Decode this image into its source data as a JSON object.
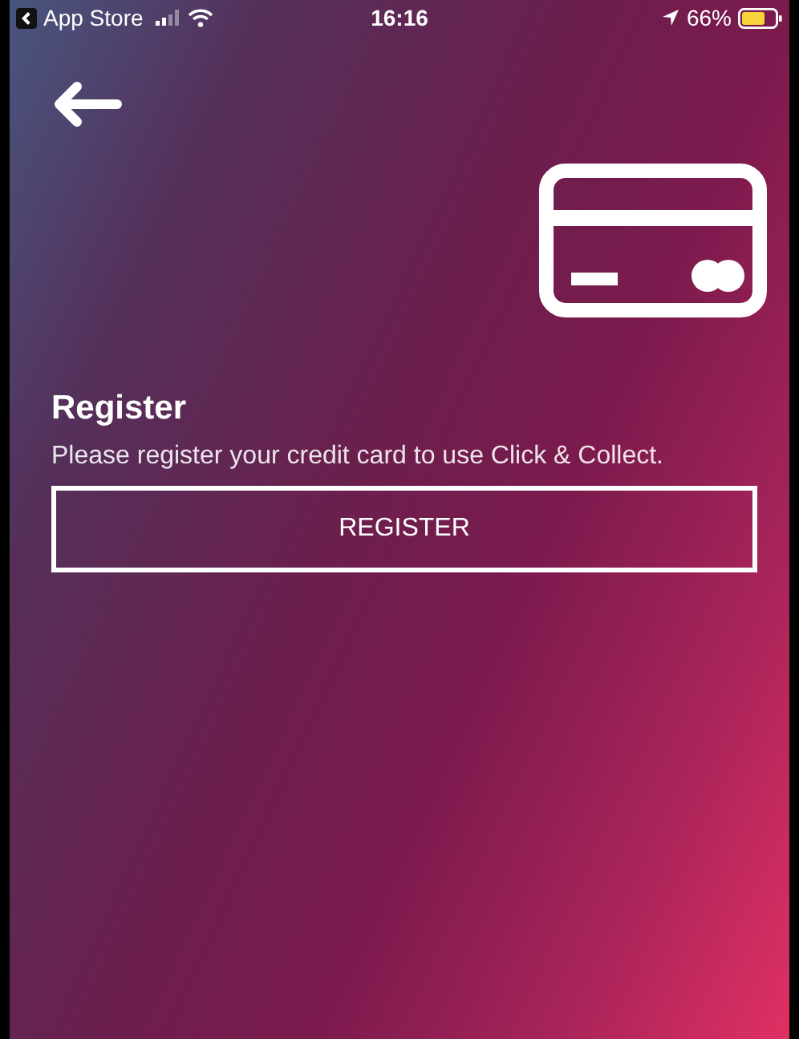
{
  "status_bar": {
    "back_app": "App Store",
    "time": "16:16",
    "battery": "66%"
  },
  "section": {
    "title": "Register",
    "description": "Please register your credit card to use Click & Collect."
  },
  "buttons": [
    "REGISTER"
  ]
}
